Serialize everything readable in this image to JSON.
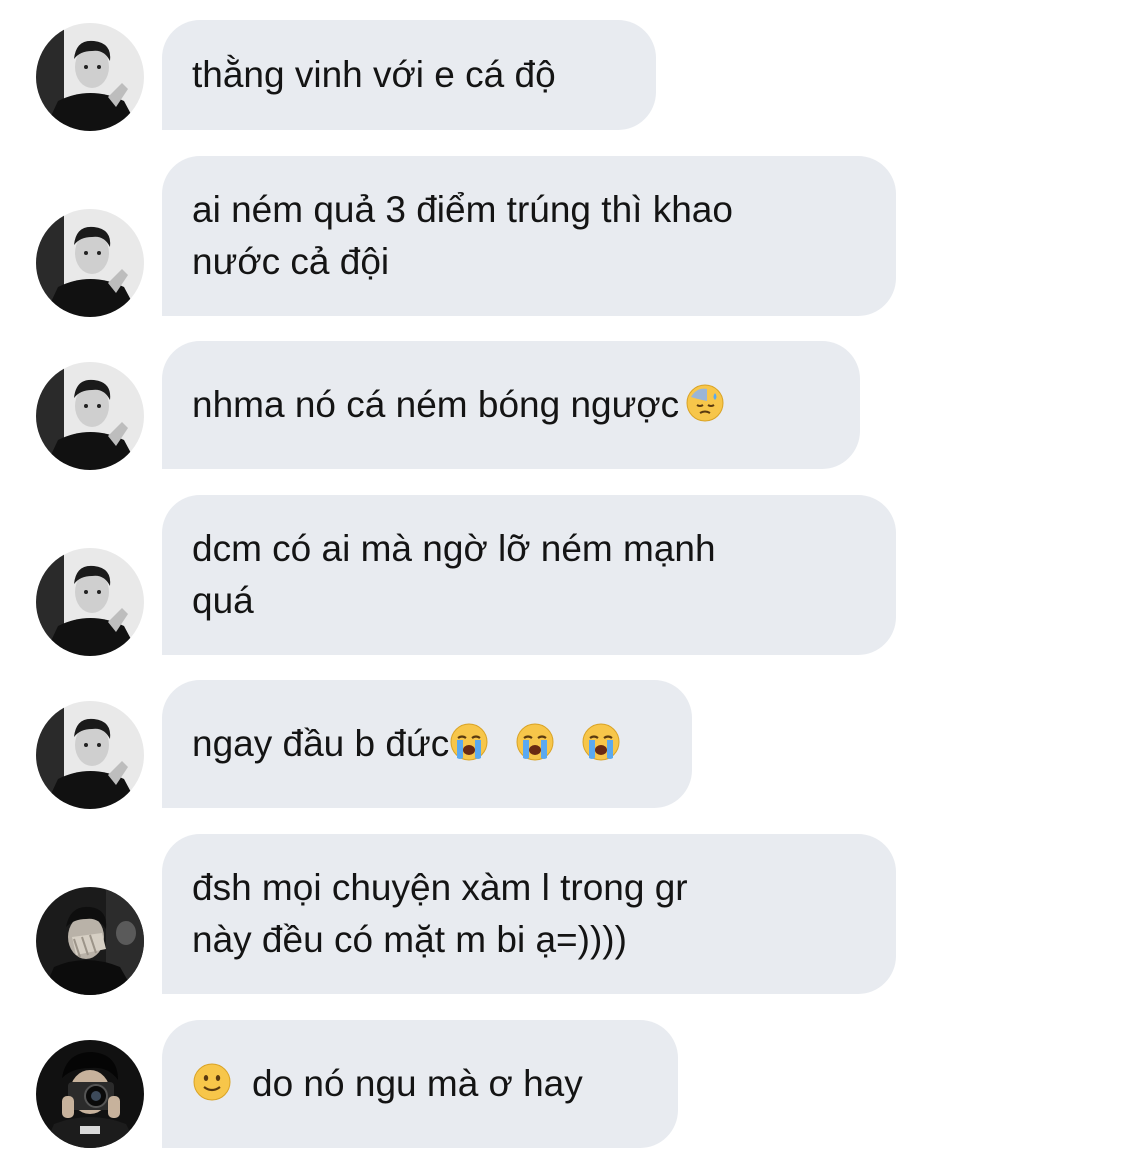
{
  "messages": [
    {
      "lines": [
        "thằng vinh với e cá độ"
      ],
      "avatar": "dark-portrait-avatar-a"
    },
    {
      "lines": [
        "ai ném quả 3 điểm trúng thì khao",
        "nước cả đội"
      ],
      "avatar": "dark-portrait-avatar-a"
    },
    {
      "text": "nhma nó cá ném bóng ngược",
      "emoji": "downcast-sweat-face-emoji",
      "avatar": "dark-portrait-avatar-a"
    },
    {
      "lines": [
        "dcm có ai mà ngờ lỡ ném mạnh",
        "quá"
      ],
      "avatar": "dark-portrait-avatar-a"
    },
    {
      "text": "ngay đầu b đức",
      "emojis": [
        "loudly-crying-face-emoji",
        "loudly-crying-face-emoji",
        "loudly-crying-face-emoji"
      ],
      "avatar": "dark-portrait-avatar-a"
    },
    {
      "lines": [
        "đsh mọi chuyện xàm l trong gr",
        "này đều có mặt m bi ạ=))))"
      ],
      "avatar": "face-covered-avatar-b"
    },
    {
      "text": "do nó ngu mà ơ hay",
      "emoji": "slightly-smiling-face-emoji",
      "avatar": "camera-avatar-c"
    }
  ],
  "colors": {
    "bubble_bg": "#e8ebf0",
    "text": "#141414",
    "page_bg": "#ffffff"
  }
}
